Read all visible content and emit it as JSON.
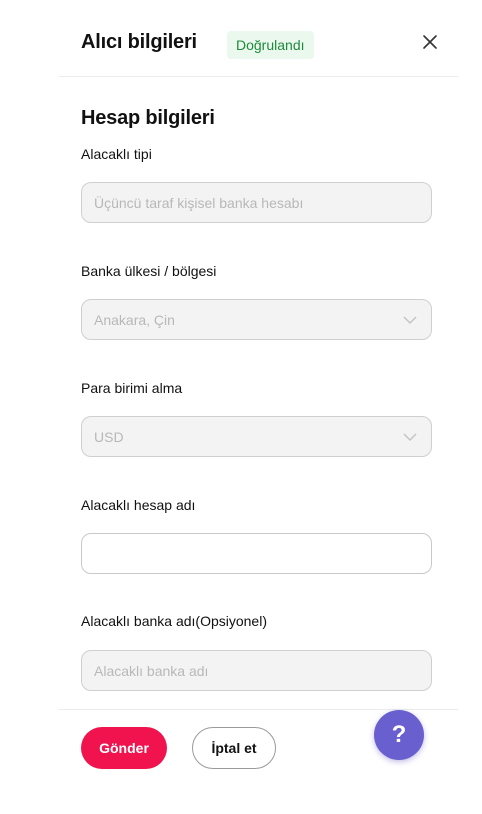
{
  "header": {
    "title": "Alıcı bilgileri",
    "badge": "Doğrulandı",
    "close_icon": "close-icon"
  },
  "section": {
    "title": "Hesap bilgileri"
  },
  "fields": {
    "payee_type": {
      "label": "Alacaklı tipi",
      "value": "Üçüncü taraf kişisel banka hesabı"
    },
    "bank_country": {
      "label": "Banka ülkesi / bölgesi",
      "value": "Anakara, Çin"
    },
    "currency": {
      "label": "Para birimi alma",
      "value": "USD"
    },
    "account_name": {
      "label": "Alacaklı hesap adı",
      "value": "",
      "placeholder": ""
    },
    "bank_name": {
      "label": "Alacaklı banka adı(Opsiyonel)",
      "value": "",
      "placeholder": "Alacaklı banka adı"
    }
  },
  "footer": {
    "submit_label": "Gönder",
    "cancel_label": "İptal et"
  },
  "help": {
    "label": "?",
    "icon": "help-icon"
  },
  "colors": {
    "primary": "#f0134d",
    "badge_bg": "#ebf8ee",
    "badge_text": "#1f8a3c",
    "help_bg": "#6a5fcf"
  }
}
